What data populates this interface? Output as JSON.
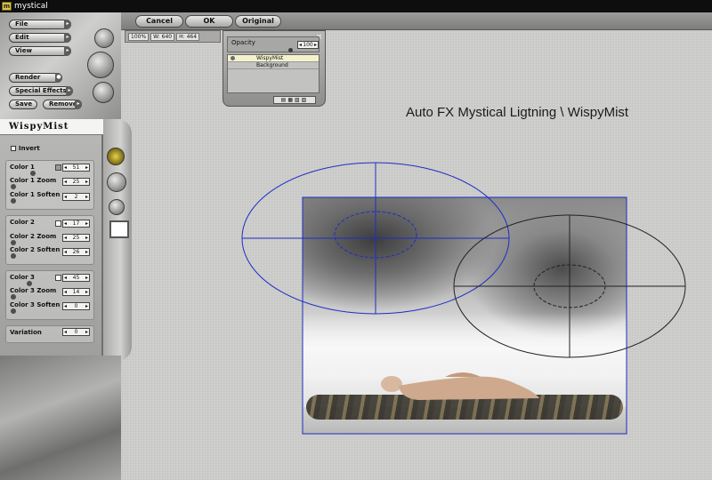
{
  "window": {
    "title": "mystical"
  },
  "toolbar": {
    "cancel_label": "Cancel",
    "ok_label": "OK",
    "original_label": "Original"
  },
  "info": {
    "zoom": "100%",
    "width_label": "W: 640",
    "height_label": "H: 464"
  },
  "sidebar": {
    "file_label": "File",
    "edit_label": "Edit",
    "view_label": "View",
    "render_label": "Render",
    "special_effects_label": "Special Effects",
    "save_label": "Save",
    "remove_label": "Remove"
  },
  "layers": {
    "opacity_label": "Opacity",
    "opacity_value": "100",
    "items": [
      "WispyMist",
      "Background"
    ],
    "selected": "WispyMist"
  },
  "effect": {
    "title": "WispyMist",
    "invert_label": "Invert",
    "params": [
      {
        "label": "Color 1",
        "value": "51",
        "swatch": "#9a9a9a"
      },
      {
        "label": "Color 1 Zoom",
        "value": "25"
      },
      {
        "label": "Color 1 Soften",
        "value": "2"
      },
      {
        "label": "Color 2",
        "value": "17",
        "swatch": "#ffffff"
      },
      {
        "label": "Color 2 Zoom",
        "value": "25"
      },
      {
        "label": "Color 2 Soften",
        "value": "26"
      },
      {
        "label": "Color 3",
        "value": "45",
        "swatch": "#ffffff"
      },
      {
        "label": "Color 3 Zoom",
        "value": "14"
      },
      {
        "label": "Color 3 Soften",
        "value": "0"
      },
      {
        "label": "Variation",
        "value": "0"
      }
    ]
  },
  "canvas": {
    "title": "Auto FX Mystical Ligtning \\ WispyMist"
  },
  "icons": {
    "app": "mystical-app-icon",
    "render_toggle": "render-toggle-icon",
    "color_preview": "color-preview-swatch"
  },
  "colors": {
    "guide_blue": "#1c2ec4",
    "guide_black": "#111111",
    "accent_select": "#f4f2cc"
  }
}
